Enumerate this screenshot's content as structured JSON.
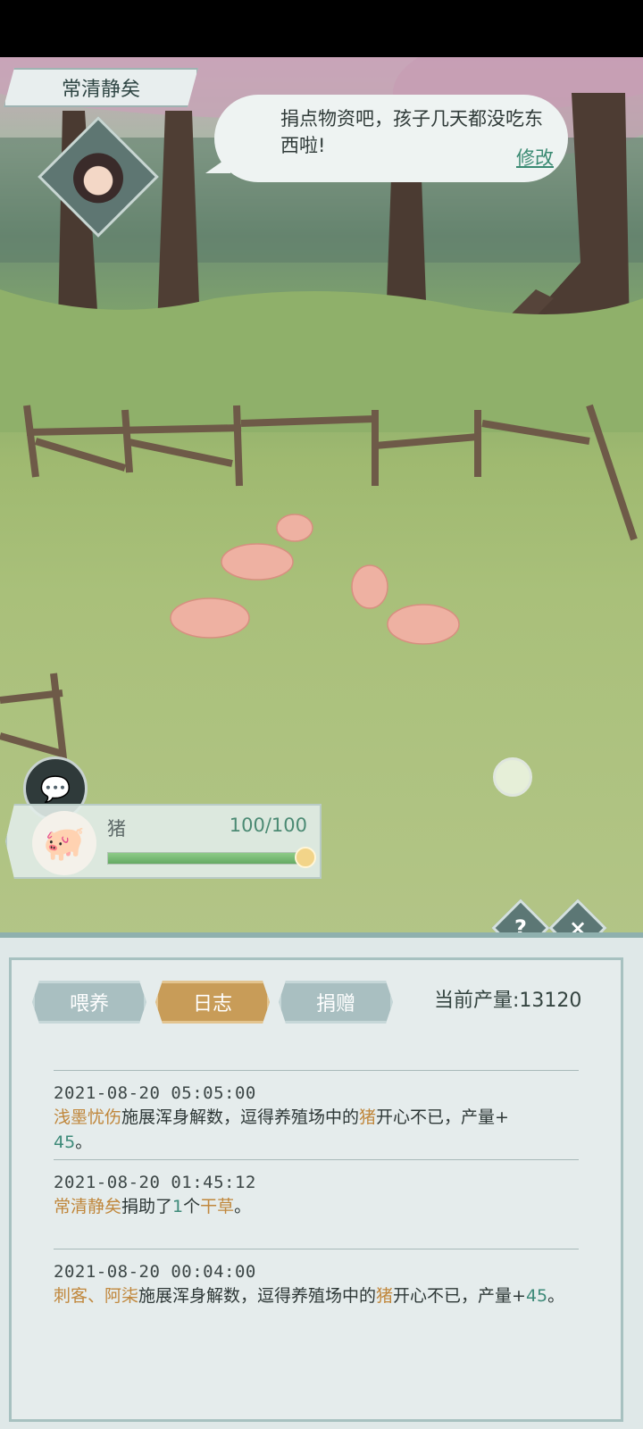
{
  "npc": {
    "name": "常清静矣",
    "speech": "捐点物资吧，孩子几天都没吃东西啦!",
    "edit_label": "修改"
  },
  "farm_card": {
    "animal_name": "猪",
    "count_text": "100/100",
    "fill_fraction": 1.0
  },
  "controls": {
    "help_label": "?",
    "close_label": "×",
    "chat_icon": "chat-icon"
  },
  "panel": {
    "tabs": [
      {
        "label": "喂养",
        "active": false
      },
      {
        "label": "日志",
        "active": true
      },
      {
        "label": "捐赠",
        "active": false
      }
    ],
    "production_label": "当前产量:13120"
  },
  "log_entries": [
    {
      "time": "2021-08-20  05:05:00",
      "actor": "浅墨忧伤",
      "text_a": "施展浑身解数，逗得养殖场中的",
      "target": "猪",
      "text_b": "开心不已，产量+",
      "amount": "45",
      "tail": "。"
    },
    {
      "time": "2021-08-20  01:45:12",
      "actor": "常清静矣",
      "text_a": "捐助了",
      "amount": "1",
      "text_b": "个",
      "target": "干草",
      "tail": "。"
    },
    {
      "time": "2021-08-20  00:04:00",
      "actor": "刺客、阿柒",
      "text_a": "施展浑身解数，逗得养殖场中的",
      "target": "猪",
      "text_b": "开心不已，产量+",
      "amount": "45",
      "tail": "。"
    }
  ]
}
